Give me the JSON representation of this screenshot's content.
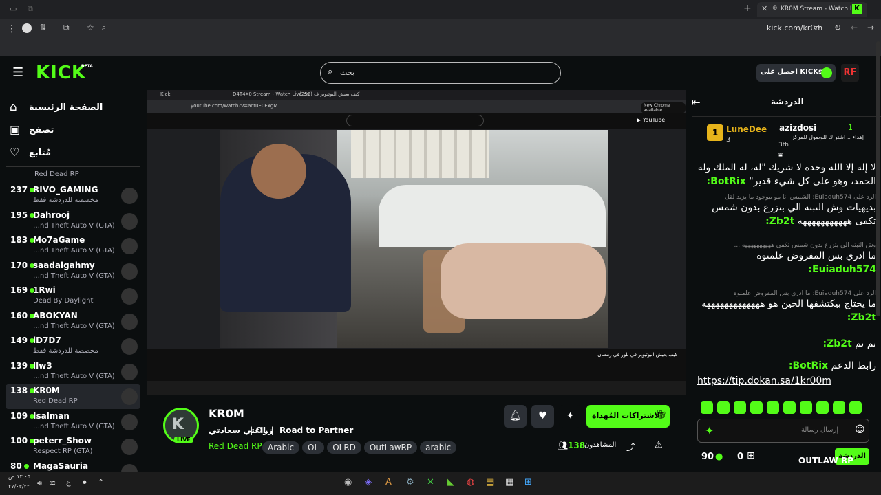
{
  "browser": {
    "tab_title": "KR0M Stream - Watch Live",
    "url": "kick.com/kr0m"
  },
  "topnav": {
    "search_placeholder": "بحث",
    "get_kicks": "احصل على KICKs",
    "logo": "KICK",
    "beta": "BETA"
  },
  "sidebar": {
    "nav": [
      {
        "label": "الصفحة الرئيسية",
        "icon": "home-icon"
      },
      {
        "label": "تصفح",
        "icon": "browse-icon"
      },
      {
        "label": "مُتابع",
        "icon": "heart-icon"
      }
    ],
    "partial_top": "Red Dead RP",
    "channels": [
      {
        "viewers": "237",
        "name": "RIVO_GAMING",
        "game": "مخصصة للدردشة فقط"
      },
      {
        "viewers": "195",
        "name": "Dahrooj",
        "game": "…nd Theft Auto V (GTA)"
      },
      {
        "viewers": "183",
        "name": "Mo7aGame",
        "game": "…nd Theft Auto V (GTA)"
      },
      {
        "viewers": "170",
        "name": "saadalgahmy",
        "game": "…nd Theft Auto V (GTA)"
      },
      {
        "viewers": "169",
        "name": "1Rwi",
        "game": "Dead By Daylight"
      },
      {
        "viewers": "160",
        "name": "ABOKYAN",
        "game": "…nd Theft Auto V (GTA)"
      },
      {
        "viewers": "149",
        "name": "iD7D7",
        "game": "مخصصة للدردشة فقط"
      },
      {
        "viewers": "139",
        "name": "llw3",
        "game": "…nd Theft Auto V (GTA)"
      },
      {
        "viewers": "138",
        "name": "KR0M",
        "game": "Red Dead RP"
      },
      {
        "viewers": "109",
        "name": "Isalman",
        "game": "…nd Theft Auto V (GTA)"
      },
      {
        "viewers": "100",
        "name": "peterr_Show",
        "game": "Respect RP (GTA)"
      },
      {
        "viewers": "80",
        "name": "MagaSauria",
        "game": ""
      }
    ]
  },
  "stream": {
    "name": "KR0M",
    "live": "LIVE",
    "title_ar": "زراعتي سعادتي",
    "title_sep": "| OL |",
    "title_en": "Road to Partner",
    "category": "Red Dead RP",
    "tags": [
      "Arabic",
      "OL",
      "OLRD",
      "OutLawRP",
      "arabic"
    ],
    "viewers_label": "المشاهدون",
    "viewers": "138",
    "subscribe_btn": "الاشتراكات المُهداة",
    "inner_url": "youtube.com/watch?v=actuE0ExgM",
    "inner_video_title": "كيف يعيش اليوتيوبر في بلور في رمضان",
    "inner_tabs": [
      "Kick",
      "D4T4X0 Stream - Watch Live on",
      "(253) كيف يعيش اليوتيوبر ف"
    ]
  },
  "chat": {
    "header": "الدردشة",
    "lead_left": {
      "name": "LuneDee",
      "rank": "3"
    },
    "lead_right": {
      "name": "azizdosi",
      "sub": "إهداء 1 اشتراك للوصول للمركز",
      "rank": "3th",
      "count": "1"
    },
    "messages": [
      {
        "user": "BotRix:",
        "text": "لا إله إلا الله وحده لا شريك \"له، له الملك وله الحمد، وهو على كل شيء قدير\"",
        "reply": ""
      },
      {
        "user": "Zb2t:",
        "text": "بديهيات وش النبته الي بتزرع بدون شمس تكفى هههههههههههه",
        "reply": "الرد على Euiaduh574: الشمس انا مو موجود ما يزيد لقل"
      },
      {
        "user": "Euiaduh574:",
        "text": "ما ادري بس المفروض علمتوه",
        "reply": "وش النبته الي بتزرع بدون شمس تكفى ههههههههههه ..."
      },
      {
        "user": "Zb2t:",
        "text": "ما يحتاج بيكتشفها الحين هو هههههههههههههه",
        "reply": "الرد على Euiaduh574: ما ادري بس المفروض علمتوه"
      },
      {
        "user": "Zb2t:",
        "text": "تم تم",
        "reply": ""
      },
      {
        "user": "BotRix:",
        "text": "رابط الدعم",
        "reply": ""
      }
    ],
    "link": "https://tip.dokan.sa/1kr00m",
    "input_placeholder": "إرسال رسالة",
    "points": "90",
    "zero": "0",
    "send_btn": "الدردشة",
    "watermark": "OUTLAW RP"
  },
  "taskbar": {
    "time": "١٢:٠٥ ص",
    "date": "٢٧/٠٣/٢٢",
    "lang": "ع"
  }
}
